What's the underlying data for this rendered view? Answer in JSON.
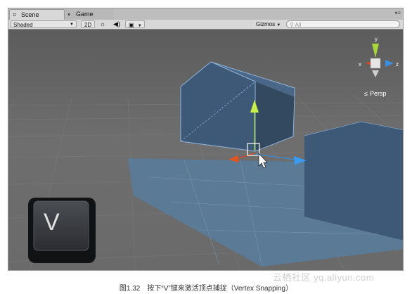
{
  "tabs": [
    {
      "icon": "scene-icon",
      "label": "Scene",
      "active": true
    },
    {
      "icon": "game-icon",
      "label": "Game",
      "active": false
    }
  ],
  "toolbar": {
    "shading_mode": "Shaded",
    "btn_2d": "2D",
    "gizmos": "Gizmos",
    "search_placeholder": "All"
  },
  "scene": {
    "key_label": "V",
    "axis_x": "x",
    "axis_y": "y",
    "axis_z": "z",
    "projection": "Persp"
  },
  "caption": "图1.32　按下“V”键来激活顶点捕捉（Vertex Snapping）",
  "watermark": "云栖社区 yq.aliyun.com",
  "colors": {
    "accent_axis_x": "#d8461f",
    "accent_axis_y": "#a7d53a",
    "accent_axis_z": "#3a8fe0"
  }
}
